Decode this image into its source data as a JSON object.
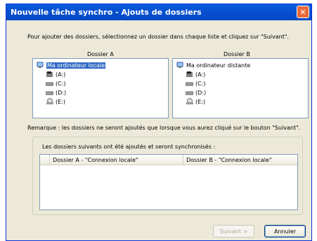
{
  "window": {
    "title": "Nouvelle tâche synchro - Ajouts de dossiers"
  },
  "instruction": "Pour ajouter des dossiers, sélectionnez un dossier dans chaque liste et cliquez sur \"Suivant\".",
  "folder_a": {
    "label": "Dossier A",
    "root": "Ma ordinateur locale",
    "drives": [
      "(A:)",
      "(C:)",
      "(D:)",
      "(E:)"
    ]
  },
  "folder_b": {
    "label": "Dossier B",
    "root": "Ma ordinateur distante",
    "drives": [
      "(A:)",
      "(C:)",
      "(D:)",
      "(E:)"
    ]
  },
  "note": "Remarque : les dossiers ne seront ajoutés que lorsque vous aurez cliqué sur le bouton \"Suivant\".",
  "added_group": {
    "label": "Les dossiers suivants ont été ajoutés et seront synchronisés :",
    "columns": [
      "Dossier A - \"Connexion locale\"",
      "Dossier B - \"Connexion locale\""
    ]
  },
  "buttons": {
    "next": "Suivant >",
    "cancel": "Annuler"
  }
}
